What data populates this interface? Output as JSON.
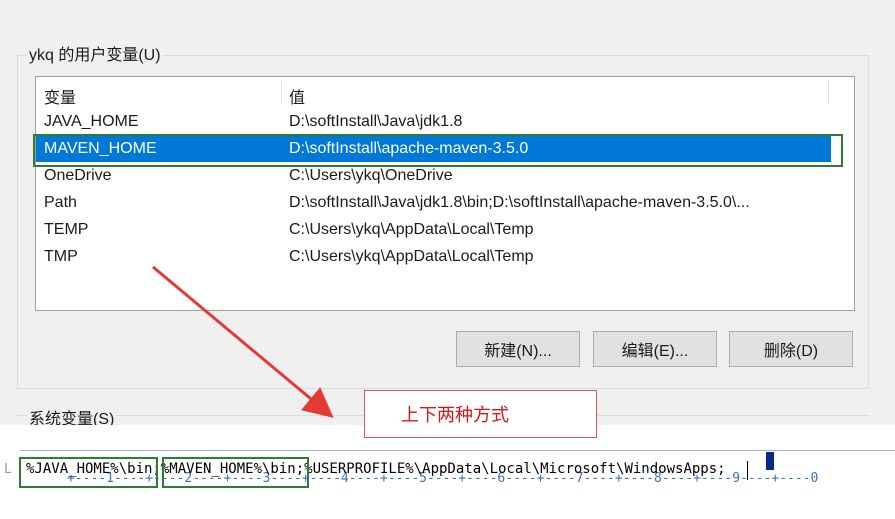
{
  "user_vars": {
    "group_title": "ykq 的用户变量(U)",
    "col_name": "变量",
    "col_value": "值",
    "rows": [
      {
        "name": "JAVA_HOME",
        "value": "D:\\softInstall\\Java\\jdk1.8"
      },
      {
        "name": "MAVEN_HOME",
        "value": "D:\\softInstall\\apache-maven-3.5.0"
      },
      {
        "name": "OneDrive",
        "value": "C:\\Users\\ykq\\OneDrive"
      },
      {
        "name": "Path",
        "value": "D:\\softInstall\\Java\\jdk1.8\\bin;D:\\softInstall\\apache-maven-3.5.0\\..."
      },
      {
        "name": "TEMP",
        "value": "C:\\Users\\ykq\\AppData\\Local\\Temp"
      },
      {
        "name": "TMP",
        "value": "C:\\Users\\ykq\\AppData\\Local\\Temp"
      }
    ],
    "selected_index": 1
  },
  "buttons": {
    "new": "新建(N)...",
    "edit": "编辑(E)...",
    "delete": "删除(D)"
  },
  "system_vars": {
    "group_title": "系统变量(S)"
  },
  "annotation": {
    "note": "上下两种方式",
    "highlight_color": "#2e7d32",
    "arrow_color": "#e53935"
  },
  "editor": {
    "ruler_text": "+----1----+----2----+----3----+----4----+----5----+----6----+----7----+----8----+----9----+----0",
    "line_text": "%JAVA_HOME%\\bin;%MAVEN_HOME%\\bin;%USERPROFILE%\\AppData\\Local\\Microsoft\\WindowsApps;",
    "gutter": "L"
  }
}
